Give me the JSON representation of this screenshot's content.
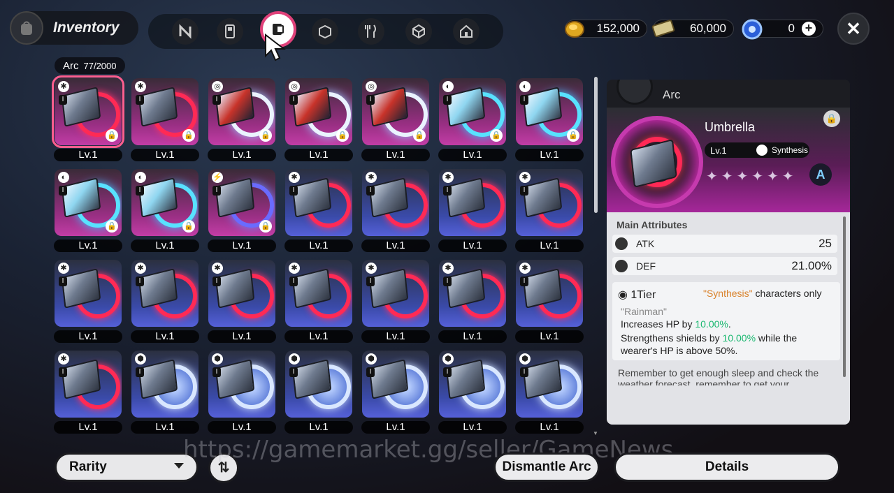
{
  "header": {
    "title": "Inventory",
    "tabs": [
      {
        "name": "tab-character",
        "icon": "n-logo-icon"
      },
      {
        "name": "tab-device",
        "icon": "handheld-icon"
      },
      {
        "name": "tab-arc",
        "icon": "arc-disc-icon",
        "active": true
      },
      {
        "name": "tab-box",
        "icon": "box-icon"
      },
      {
        "name": "tab-food",
        "icon": "fork-knife-icon"
      },
      {
        "name": "tab-material",
        "icon": "cube-icon"
      },
      {
        "name": "tab-home",
        "icon": "house-icon"
      }
    ]
  },
  "currency": {
    "gold": "152,000",
    "tickets": "60,000",
    "orbs": "0"
  },
  "grid": {
    "category": "Arc",
    "count": "77/2000",
    "level_label": "Lv.1",
    "rows": [
      [
        {
          "style": "pink",
          "art": "red",
          "locked": true,
          "selected": true
        },
        {
          "style": "pink",
          "art": "red",
          "locked": true
        },
        {
          "style": "pink",
          "art": "swirl",
          "locked": true
        },
        {
          "style": "pink",
          "art": "swirl",
          "locked": true
        },
        {
          "style": "pink",
          "art": "swirl",
          "locked": true
        },
        {
          "style": "pink",
          "art": "cyan",
          "locked": true
        },
        {
          "style": "pink",
          "art": "cyan",
          "locked": true
        }
      ],
      [
        {
          "style": "pink",
          "art": "cyan",
          "locked": true
        },
        {
          "style": "pink",
          "art": "cyan",
          "locked": true
        },
        {
          "style": "pink",
          "art": "electric",
          "locked": true
        },
        {
          "style": "blue",
          "art": "red",
          "locked": false
        },
        {
          "style": "blue",
          "art": "red",
          "locked": false
        },
        {
          "style": "blue",
          "art": "red",
          "locked": false
        },
        {
          "style": "blue",
          "art": "red",
          "locked": false
        }
      ],
      [
        {
          "style": "blue",
          "art": "red",
          "locked": false
        },
        {
          "style": "blue",
          "art": "red",
          "locked": false
        },
        {
          "style": "blue",
          "art": "red",
          "locked": false
        },
        {
          "style": "blue",
          "art": "red",
          "locked": false
        },
        {
          "style": "blue",
          "art": "red",
          "locked": false
        },
        {
          "style": "blue",
          "art": "red",
          "locked": false
        },
        {
          "style": "blue",
          "art": "red",
          "locked": false
        }
      ],
      [
        {
          "style": "blue",
          "art": "red",
          "locked": false
        },
        {
          "style": "blue",
          "art": "moon",
          "locked": false
        },
        {
          "style": "blue",
          "art": "moon",
          "locked": false
        },
        {
          "style": "blue",
          "art": "moon",
          "locked": false
        },
        {
          "style": "blue",
          "art": "moon",
          "locked": false
        },
        {
          "style": "blue",
          "art": "moon",
          "locked": false
        },
        {
          "style": "blue",
          "art": "moon",
          "locked": false
        }
      ]
    ]
  },
  "detail": {
    "type_label": "Arc",
    "name": "Umbrella",
    "level": "Lv.1",
    "affinity": "Synthesis",
    "stars": "✦✦✦✦✦✦",
    "rank": "A",
    "main_attributes_title": "Main Attributes",
    "attributes": [
      {
        "label": "ATK",
        "value": "25"
      },
      {
        "label": "DEF",
        "value": "21.00%"
      }
    ],
    "tier_label": "1Tier",
    "req_quoted": "\"Synthesis\"",
    "req_suffix": " characters only",
    "effect_name": "\"Rainman\"",
    "line1_prefix": "Increases HP by ",
    "line1_value": "10.00%",
    "line1_suffix": ".",
    "line2_prefix": "Strengthens shields by ",
    "line2_value": "10.00%",
    "line2_suffix": " while the",
    "line3": "wearer's HP is above 50%.",
    "flavor": "Remember to get enough sleep and check the weather forecast, remember to get your"
  },
  "footer": {
    "rarity_label": "Rarity",
    "dismantle_label": "Dismantle Arc",
    "details_label": "Details",
    "watermark": "https://gamemarket.gg/seller/GameNews"
  }
}
